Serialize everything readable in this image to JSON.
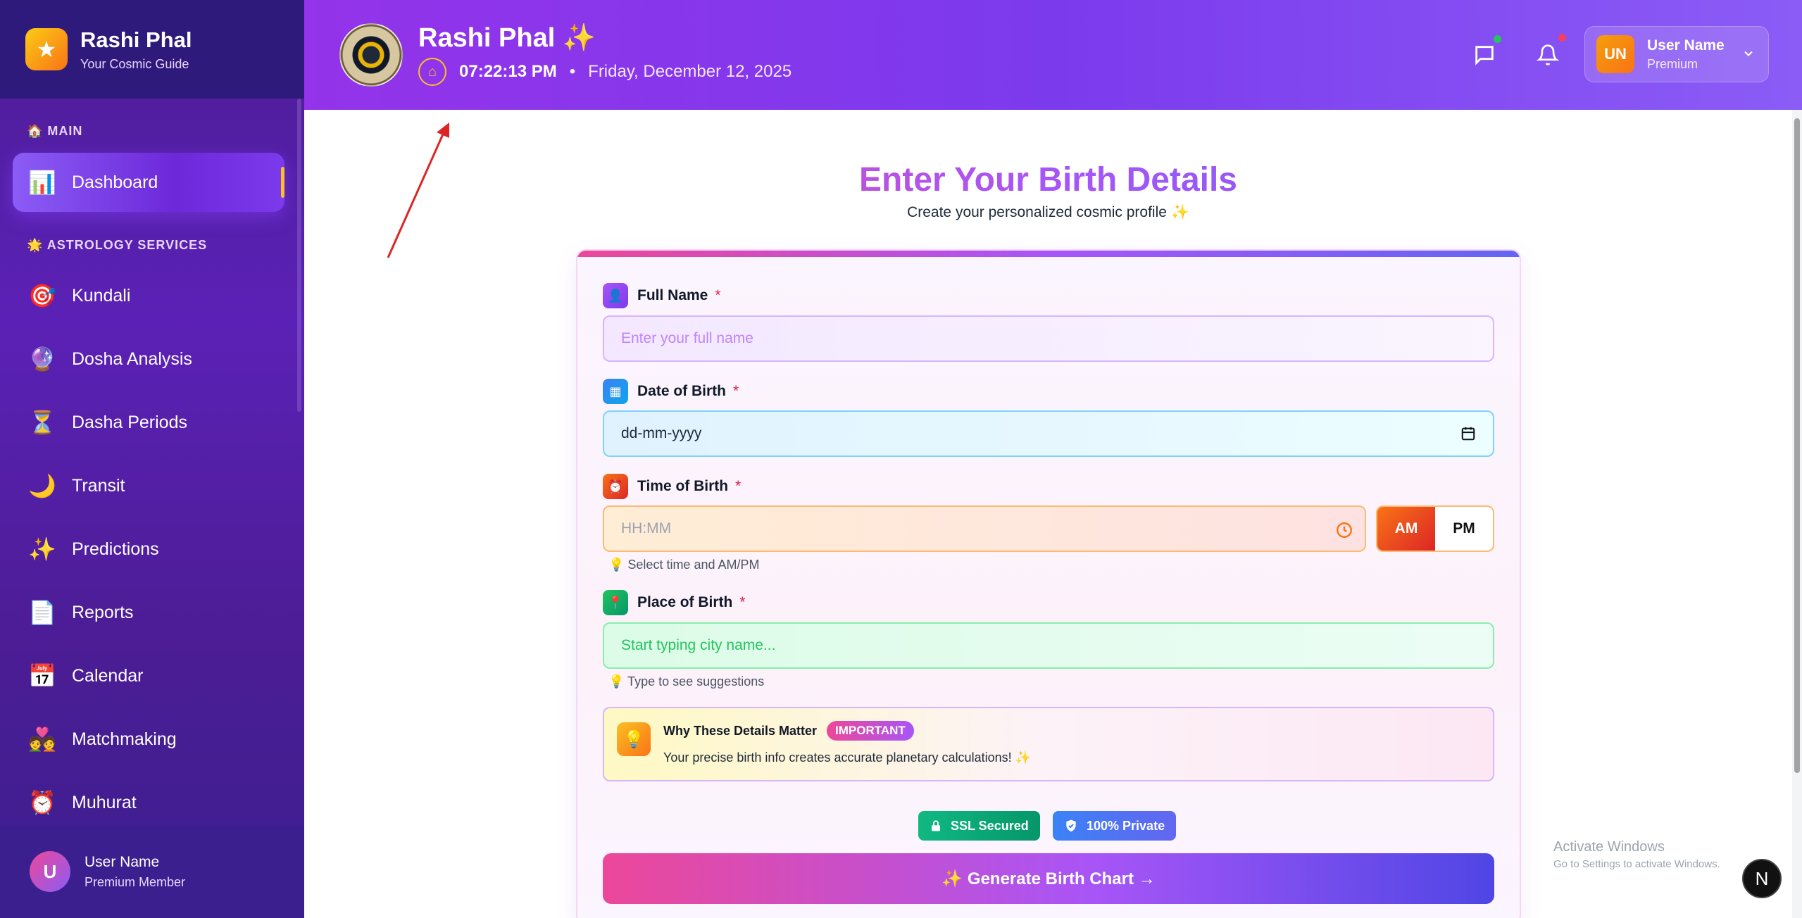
{
  "brand": {
    "title": "Rashi Phal",
    "subtitle": "Your Cosmic Guide"
  },
  "sidebar": {
    "section_main": "🏠 MAIN",
    "section_services": "🌟 ASTROLOGY SERVICES",
    "items": [
      {
        "label": "Dashboard",
        "icon": "📊",
        "icon_name": "bar-chart-icon"
      },
      {
        "label": "Kundali",
        "icon": "🎯",
        "icon_name": "target-icon"
      },
      {
        "label": "Dosha Analysis",
        "icon": "🔮",
        "icon_name": "crystal-ball-icon"
      },
      {
        "label": "Dasha Periods",
        "icon": "⏳",
        "icon_name": "hourglass-icon"
      },
      {
        "label": "Transit",
        "icon": "🌙",
        "icon_name": "moon-icon"
      },
      {
        "label": "Predictions",
        "icon": "✨",
        "icon_name": "sparkles-icon"
      },
      {
        "label": "Reports",
        "icon": "📄",
        "icon_name": "document-icon"
      },
      {
        "label": "Calendar",
        "icon": "📅",
        "icon_name": "calendar-icon"
      },
      {
        "label": "Matchmaking",
        "icon": "💑",
        "icon_name": "couple-icon"
      },
      {
        "label": "Muhurat",
        "icon": "⏰",
        "icon_name": "alarm-clock-icon"
      }
    ],
    "user": {
      "initial": "U",
      "name": "User Name",
      "role": "Premium Member"
    }
  },
  "header": {
    "title": "Rashi Phal ✨",
    "time": "07:22:13 PM",
    "separator": "•",
    "date": "Friday, December 12, 2025",
    "user": {
      "initials": "UN",
      "name": "User Name",
      "plan": "Premium"
    },
    "colors": {
      "chat_badge": "#22c55e",
      "notification_badge": "#f43f5e"
    }
  },
  "form": {
    "heading": "Enter Your Birth Details",
    "subheading": "Create your personalized cosmic profile ✨",
    "full_name": {
      "label": "Full Name",
      "required": "*",
      "placeholder": "Enter your full name"
    },
    "dob": {
      "label": "Date of Birth",
      "required": "*",
      "placeholder": "dd-mm-yyyy"
    },
    "tob": {
      "label": "Time of Birth",
      "required": "*",
      "placeholder": "HH:MM",
      "am": "AM",
      "pm": "PM",
      "selected": "AM",
      "hint": "💡  Select time and AM/PM"
    },
    "pob": {
      "label": "Place of Birth",
      "required": "*",
      "placeholder": "Start typing city name...",
      "hint": "💡  Type to see suggestions"
    },
    "info": {
      "title": "Why These Details Matter",
      "badge": "IMPORTANT",
      "text": "Your precise birth info creates accurate planetary calculations! ✨"
    },
    "trust": {
      "ssl": "SSL Secured",
      "private": "100% Private"
    },
    "submit": "✨  Generate Birth Chart  →"
  },
  "watermark": {
    "title": "Activate Windows",
    "subtitle": "Go to Settings to activate Windows."
  },
  "floating_badge": "N"
}
